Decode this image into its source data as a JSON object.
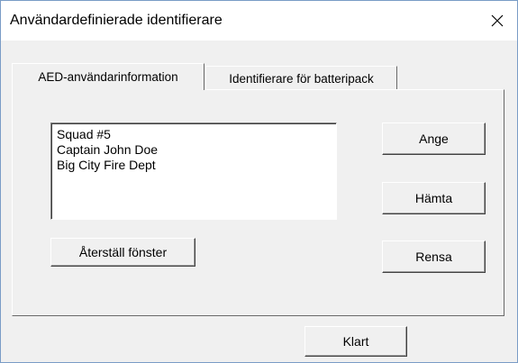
{
  "dialog": {
    "title": "Användardefinierade identifierare",
    "close_icon": "close-icon"
  },
  "tabs": [
    {
      "label": "AED-användarinformation",
      "active": true
    },
    {
      "label": "Identifierare för batteripack",
      "active": false
    }
  ],
  "user_info": {
    "lines": [
      "Squad #5",
      "Captain John Doe",
      "Big City Fire Dept"
    ]
  },
  "buttons": {
    "set": "Ange",
    "fetch": "Hämta",
    "clear": "Rensa",
    "reset_window": "Återställ fönster",
    "done": "Klart"
  }
}
